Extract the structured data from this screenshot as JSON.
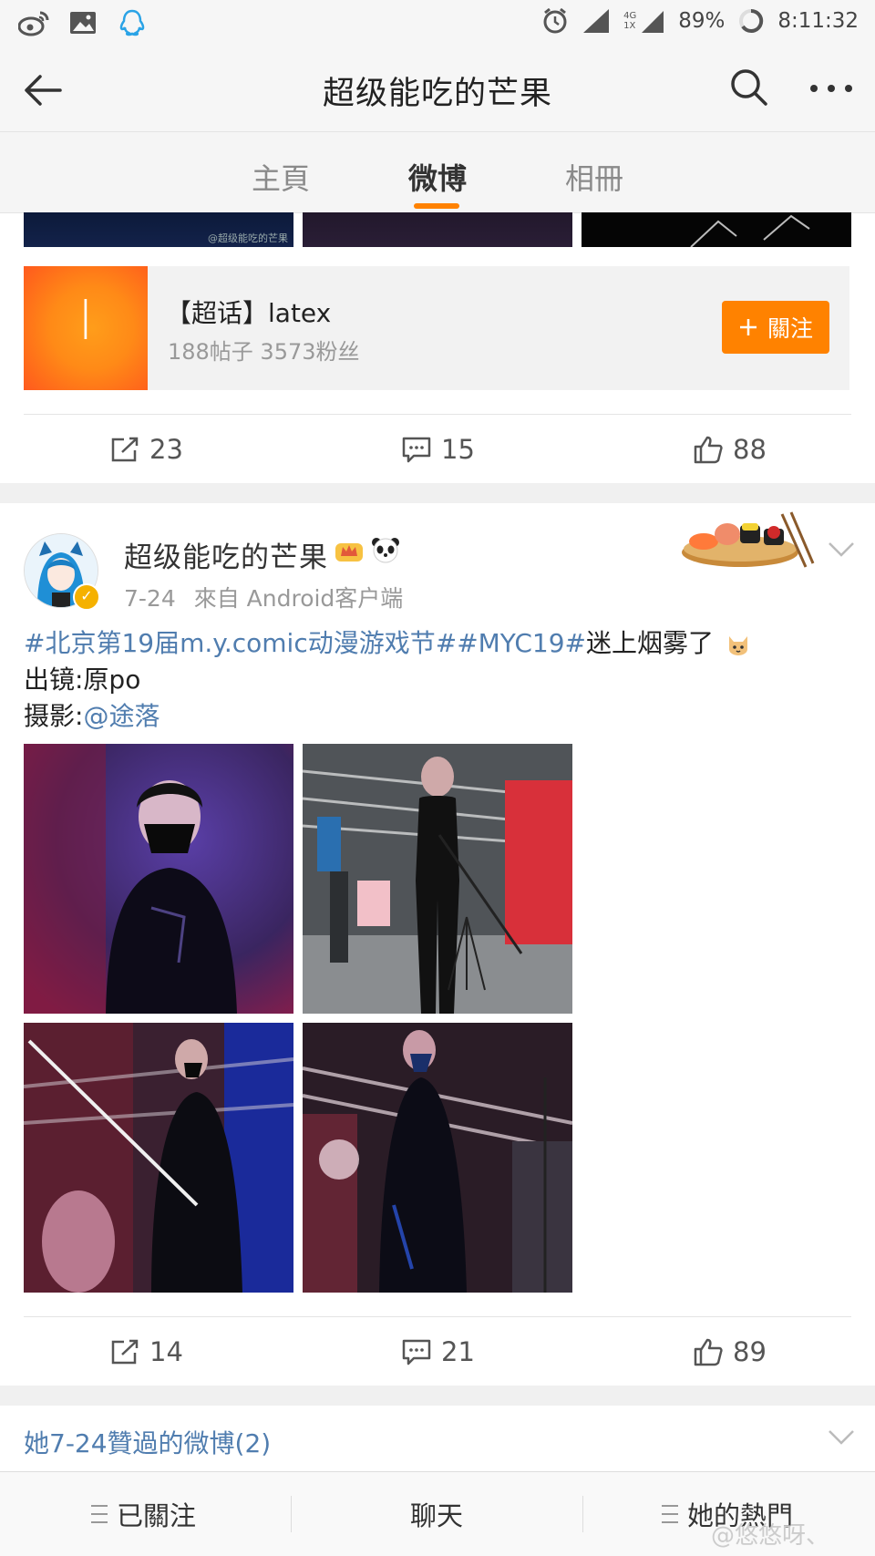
{
  "status_bar": {
    "battery": "89%",
    "time": "8:11:32",
    "network_top": "4G",
    "network_bottom": "1X",
    "icons": [
      "weibo-icon",
      "gallery-icon",
      "qq-icon",
      "alarm-icon",
      "signal-icon",
      "signal-icon",
      "battery-icon"
    ]
  },
  "nav": {
    "title": "超级能吃的芒果"
  },
  "tabs": [
    {
      "label": "主頁",
      "active": false
    },
    {
      "label": "微博",
      "active": true
    },
    {
      "label": "相冊",
      "active": false
    }
  ],
  "prev_post": {
    "strip_watermark": "@超级能吃的芒果",
    "supertopic": {
      "logo_letter": "l",
      "name": "【超话】latex",
      "stats": "188帖子 3573粉丝",
      "follow_label": "關注"
    },
    "actions": {
      "reposts": "23",
      "comments": "15",
      "likes": "88"
    }
  },
  "post": {
    "author": "超级能吃的芒果",
    "date": "7-24",
    "source": "來自 Android客户端",
    "tag1": "#北京第19届m.y.comic动漫游戏节#",
    "tag2": "#MYC19#",
    "text_tail": "迷上烟雾了",
    "line2": "出镜:原po",
    "line3_prefix": "摄影:",
    "mention": "@途落",
    "actions": {
      "reposts": "14",
      "comments": "21",
      "likes": "89"
    }
  },
  "liked_link": "她7-24贊過的微博(2)",
  "bottom_bar": {
    "following": "已關注",
    "chat": "聊天",
    "hot": "她的熱門"
  },
  "watermark": "@悠悠呀、",
  "colors": {
    "accent": "#ff8200",
    "link": "#507daf"
  }
}
